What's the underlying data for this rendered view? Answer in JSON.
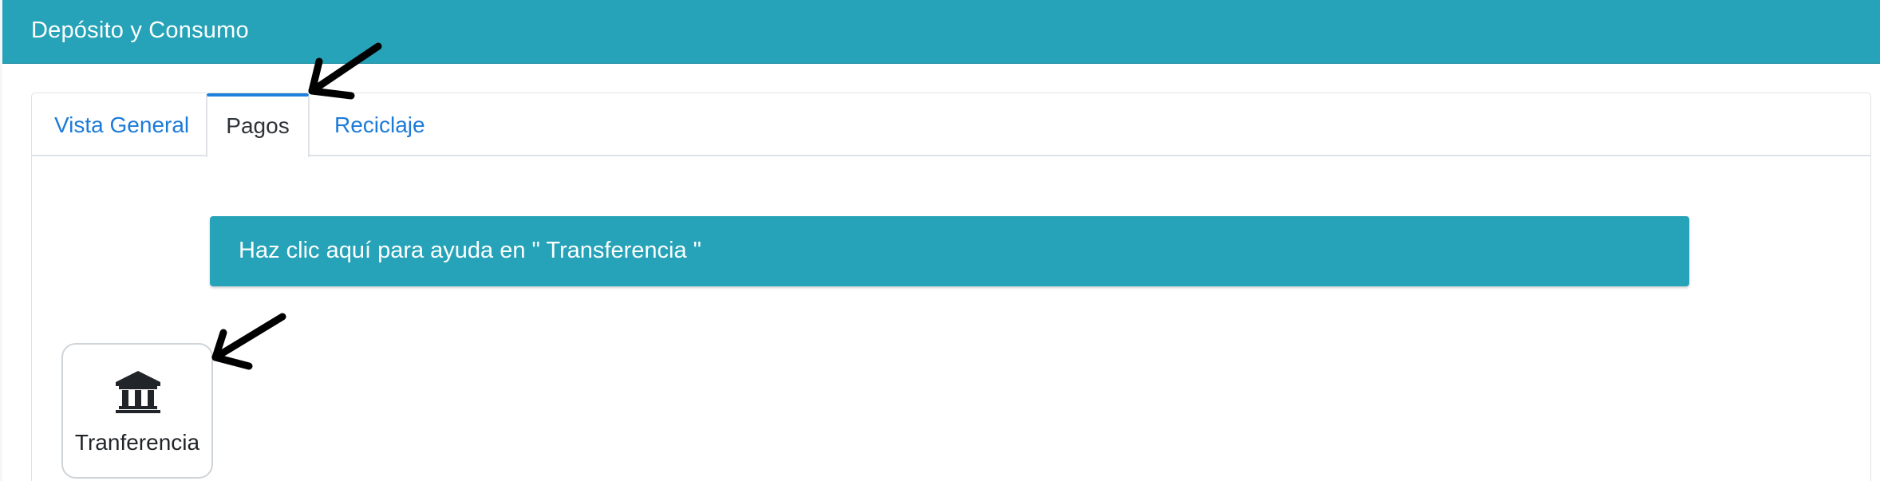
{
  "header": {
    "title": "Depósito y Consumo"
  },
  "tabs": [
    {
      "label": "Vista General",
      "active": false
    },
    {
      "label": "Pagos",
      "active": true
    },
    {
      "label": "Reciclaje",
      "active": false
    }
  ],
  "help_banner": {
    "text": "Haz clic aquí para ayuda en \" Transferencia \""
  },
  "payment_methods": [
    {
      "label": "Tranferencia",
      "icon": "bank-icon"
    }
  ],
  "colors": {
    "header_bg": "#26a3b8",
    "banner_bg": "#26a3b8",
    "tab_link": "#1c7bd8",
    "active_tab_border": "#1f80db",
    "annotation_arrow": "#000000"
  }
}
